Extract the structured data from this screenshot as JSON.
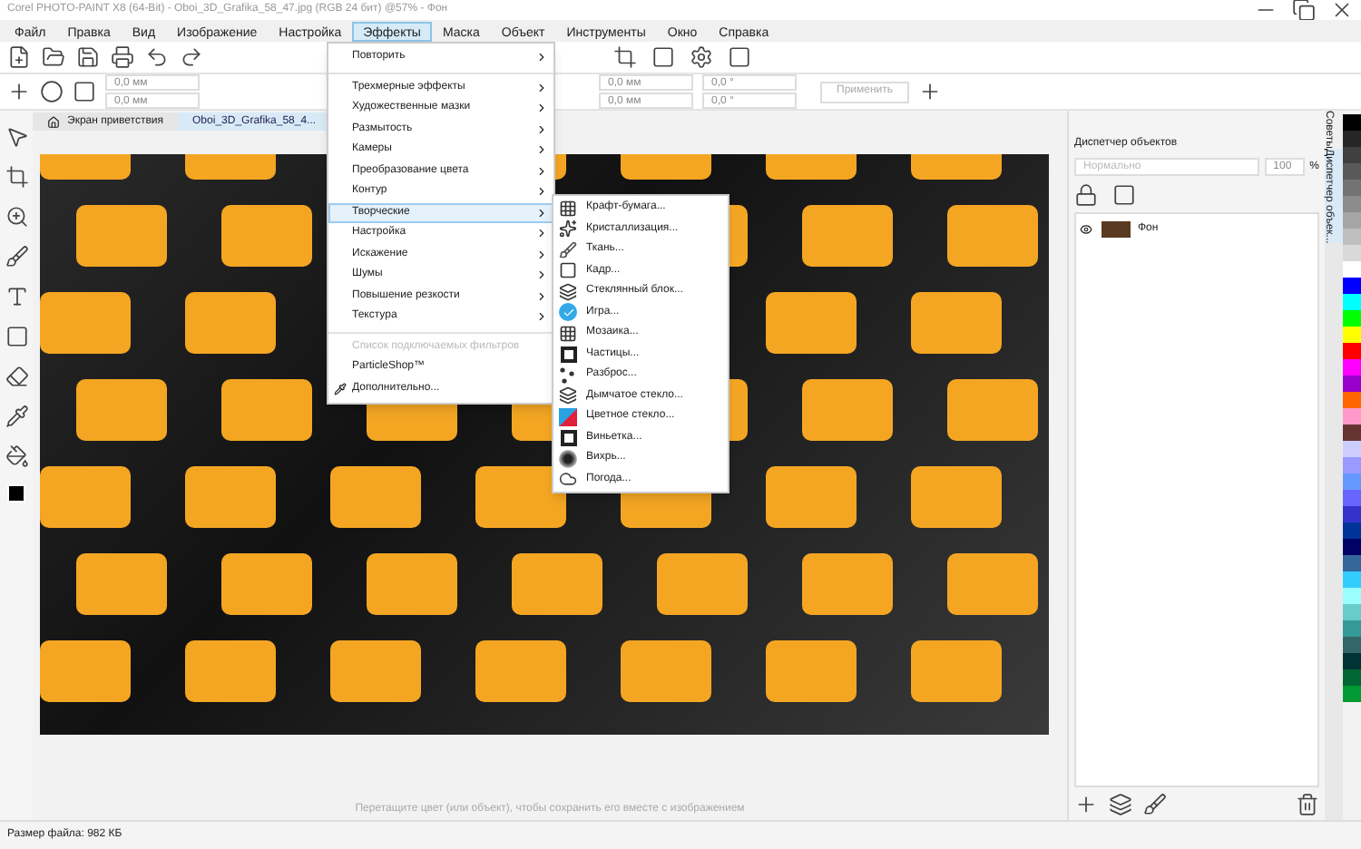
{
  "window": {
    "title": "Corel PHOTO-PAINT X8 (64-Bit) - Oboi_3D_Grafika_58_47.jpg (RGB 24 бит) @57% - Фон"
  },
  "menu_bar": [
    {
      "label": "Файл",
      "selected": false
    },
    {
      "label": "Правка",
      "selected": false
    },
    {
      "label": "Вид",
      "selected": false
    },
    {
      "label": "Изображение",
      "selected": false
    },
    {
      "label": "Настройка",
      "selected": false
    },
    {
      "label": "Эффекты",
      "selected": true
    },
    {
      "label": "Маска",
      "selected": false
    },
    {
      "label": "Объект",
      "selected": false
    },
    {
      "label": "Инструменты",
      "selected": false
    },
    {
      "label": "Окно",
      "selected": false
    },
    {
      "label": "Справка",
      "selected": false
    }
  ],
  "property_bar": {
    "fields_left": [
      "0,0 мм",
      "0,0 мм"
    ],
    "fields_right": [
      "0,0 мм",
      "0,0 мм"
    ],
    "angles": [
      "0,0 °",
      "0,0 °"
    ],
    "apply_button": {
      "label": "Применить",
      "disabled": true
    }
  },
  "tabs": [
    {
      "label": "Экран приветствия",
      "selected": false
    },
    {
      "label": "Oboi_3D_Grafika_58_4...",
      "selected": true
    }
  ],
  "effects_menu": {
    "items": [
      {
        "kind": "item",
        "label": "Повторить",
        "submenu": true,
        "selected": false,
        "disabled": false
      },
      {
        "kind": "separator"
      },
      {
        "kind": "item",
        "label": "Трехмерные эффекты",
        "submenu": true,
        "selected": false,
        "disabled": false
      },
      {
        "kind": "item",
        "label": "Художественные мазки",
        "submenu": true,
        "selected": false,
        "disabled": false
      },
      {
        "kind": "item",
        "label": "Размытость",
        "submenu": true,
        "selected": false,
        "disabled": false
      },
      {
        "kind": "item",
        "label": "Камеры",
        "submenu": true,
        "selected": false,
        "disabled": false
      },
      {
        "kind": "item",
        "label": "Преобразование цвета",
        "submenu": true,
        "selected": false,
        "disabled": false
      },
      {
        "kind": "item",
        "label": "Контур",
        "submenu": true,
        "selected": false,
        "disabled": false
      },
      {
        "kind": "item",
        "label": "Творческие",
        "submenu": true,
        "selected": true,
        "disabled": false
      },
      {
        "kind": "item",
        "label": "Настройка",
        "submenu": true,
        "selected": false,
        "disabled": false
      },
      {
        "kind": "item",
        "label": "Искажение",
        "submenu": true,
        "selected": false,
        "disabled": false
      },
      {
        "kind": "item",
        "label": "Шумы",
        "submenu": true,
        "selected": false,
        "disabled": false
      },
      {
        "kind": "item",
        "label": "Повышение резкости",
        "submenu": true,
        "selected": false,
        "disabled": false
      },
      {
        "kind": "item",
        "label": "Текстура",
        "submenu": true,
        "selected": false,
        "disabled": false
      },
      {
        "kind": "separator"
      },
      {
        "kind": "item",
        "label": "Список подключаемых фильтров",
        "submenu": false,
        "selected": false,
        "disabled": true
      },
      {
        "kind": "item",
        "label": "ParticleShop™",
        "submenu": false,
        "selected": false,
        "disabled": false
      },
      {
        "kind": "plugin",
        "label": "Дополнительно...",
        "submenu": false,
        "selected": false,
        "disabled": false
      }
    ]
  },
  "creative_submenu": {
    "items": [
      {
        "label": "Крафт-бумага..."
      },
      {
        "label": "Кристаллизация..."
      },
      {
        "label": "Ткань..."
      },
      {
        "label": "Кадр..."
      },
      {
        "label": "Стеклянный блок..."
      },
      {
        "label": "Игра..."
      },
      {
        "label": "Мозаика..."
      },
      {
        "label": "Частицы..."
      },
      {
        "label": "Разброс..."
      },
      {
        "label": "Дымчатое стекло..."
      },
      {
        "label": "Цветное стекло..."
      },
      {
        "label": "Виньетка..."
      },
      {
        "label": "Вихрь..."
      },
      {
        "label": "Погода..."
      }
    ]
  },
  "object_manager": {
    "title": "Диспетчер объектов",
    "blend_mode": {
      "placeholder": "Нормально"
    },
    "opacity": "100",
    "opacity_unit": "%",
    "layers": [
      {
        "name": "Фон",
        "visible": true
      }
    ]
  },
  "side_tabs": [
    {
      "label": "Советы",
      "selected": false
    },
    {
      "label": "Диспетчер объек...",
      "selected": true
    }
  ],
  "status_hint": "Перетащите цвет (или объект), чтобы сохранить его вместе с изображением",
  "status_bar": {
    "file_size": "Размер файла: 982 КБ"
  }
}
